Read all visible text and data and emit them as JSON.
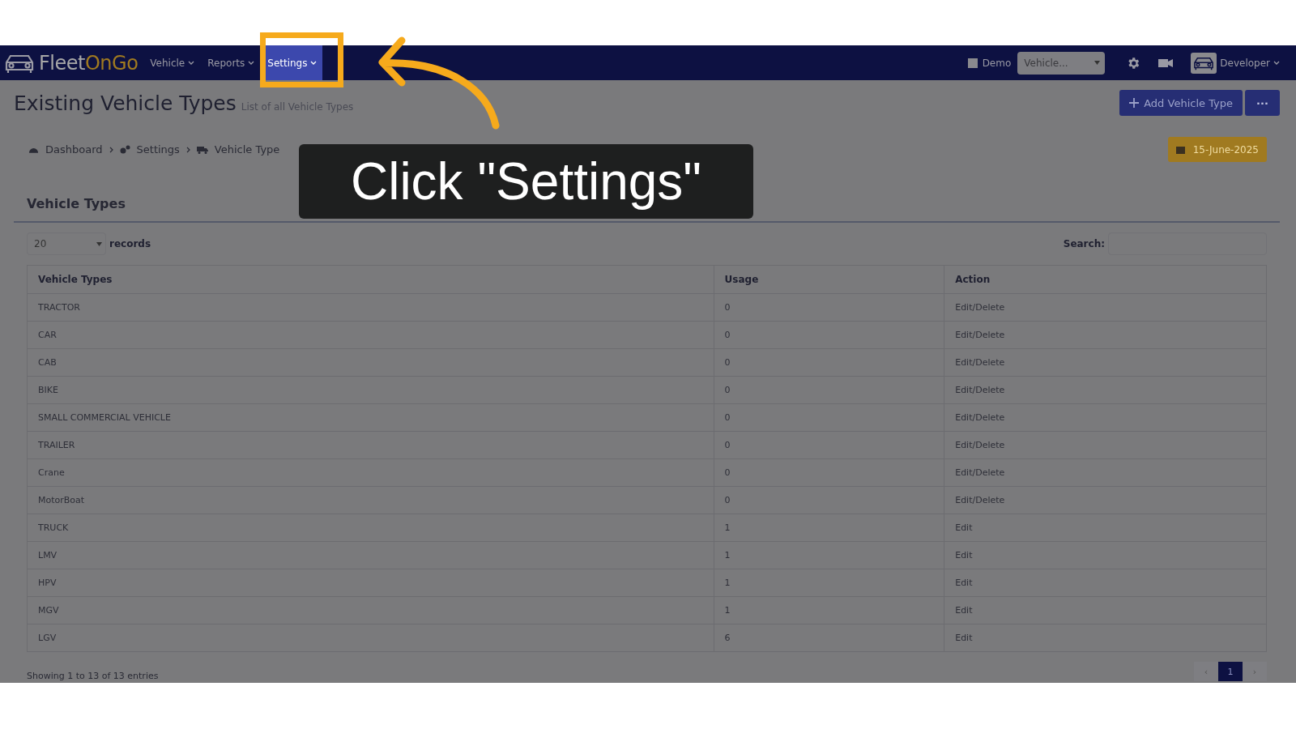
{
  "brand": {
    "name_parts": [
      "Fleet",
      "On",
      "Go"
    ]
  },
  "nav": [
    {
      "label": "Vehicle",
      "selected": false
    },
    {
      "label": "Reports",
      "selected": false
    },
    {
      "label": "Settings",
      "selected": true
    }
  ],
  "topbar": {
    "demo": {
      "label": "Demo",
      "checked": false
    },
    "vehicle_select": {
      "value": "Vehicle..."
    },
    "user": "Developer"
  },
  "page": {
    "title": "Existing Vehicle Types",
    "subtitle": "List of all Vehicle Types",
    "add_button": "Add Vehicle Type",
    "more_button": "···"
  },
  "breadcrumb": [
    "Dashboard",
    "Settings",
    "Vehicle Type"
  ],
  "date": "15-June-2025",
  "panel": {
    "title": "Vehicle Types",
    "page_size": "20",
    "records_label": "records",
    "search_label": "Search:"
  },
  "table": {
    "columns": [
      "Vehicle Types",
      "Usage",
      "Action"
    ],
    "rows": [
      [
        "TRACTOR",
        "0",
        "Edit/Delete"
      ],
      [
        "CAR",
        "0",
        "Edit/Delete"
      ],
      [
        "CAB",
        "0",
        "Edit/Delete"
      ],
      [
        "BIKE",
        "0",
        "Edit/Delete"
      ],
      [
        "SMALL COMMERCIAL VEHICLE",
        "0",
        "Edit/Delete"
      ],
      [
        "TRAILER",
        "0",
        "Edit/Delete"
      ],
      [
        "Crane",
        "0",
        "Edit/Delete"
      ],
      [
        "MotorBoat",
        "0",
        "Edit/Delete"
      ],
      [
        "TRUCK",
        "1",
        "Edit"
      ],
      [
        "LMV",
        "1",
        "Edit"
      ],
      [
        "HPV",
        "1",
        "Edit"
      ],
      [
        "MGV",
        "1",
        "Edit"
      ],
      [
        "LGV",
        "6",
        "Edit"
      ]
    ]
  },
  "footer": {
    "info": "Showing 1 to 13 of 13 entries",
    "pagination": [
      {
        "label": "‹",
        "selected": false
      },
      {
        "label": "1",
        "selected": true
      },
      {
        "label": "›",
        "selected": false
      }
    ]
  },
  "callout": {
    "text": "Click \"Settings\""
  }
}
